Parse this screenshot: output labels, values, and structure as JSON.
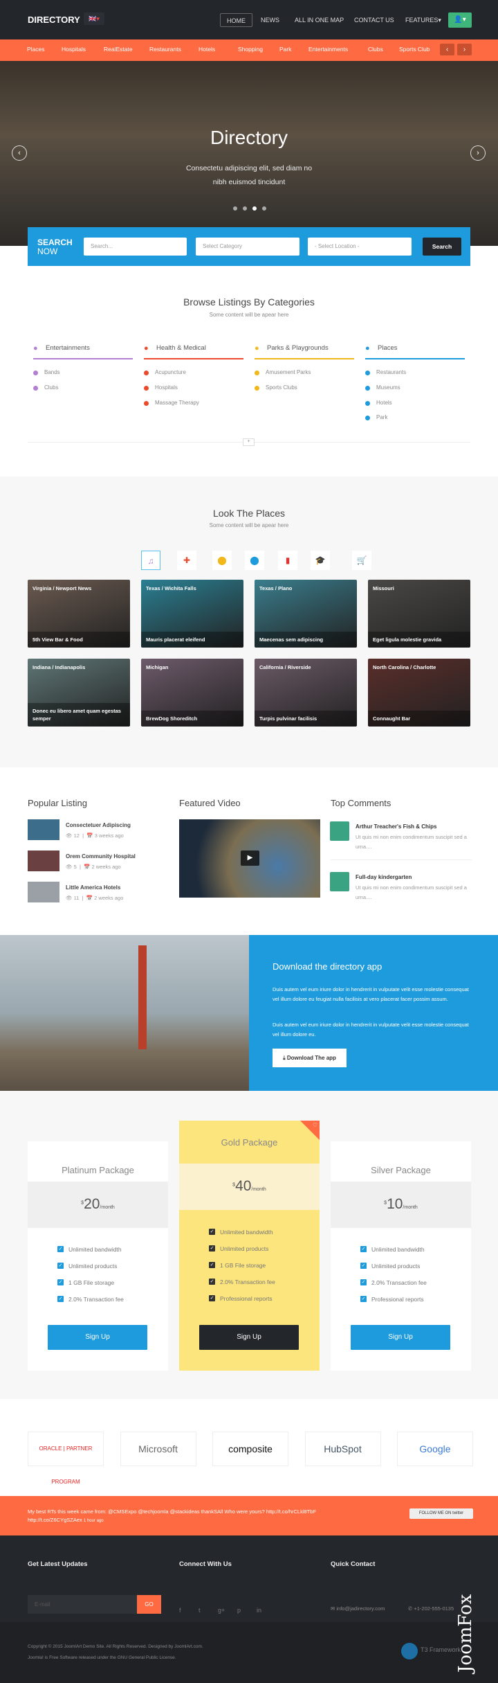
{
  "header": {
    "logo": "DIRECTORY",
    "lang": "🇬🇧▾",
    "nav": [
      "HOME",
      "NEWS",
      "ALL IN ONE MAP",
      "CONTACT US",
      "FEATURES▾"
    ],
    "user_icon": "user-icon"
  },
  "category_bar": {
    "items": [
      "Places",
      "Hospitals",
      "RealEstate",
      "Restaurants",
      "Hotels",
      "Shopping",
      "Park",
      "Entertainments",
      "Clubs",
      "Sports Club"
    ],
    "prev": "‹",
    "next": "›"
  },
  "hero": {
    "title": "Directory",
    "subtitle": "Consectetu adipiscing elit, sed diam no nibh euismod tincidunt",
    "slides": 4,
    "active_slide": 3
  },
  "search": {
    "title": "SEARCH",
    "title2": "NOW",
    "placeholder": "Search...",
    "category": "Select Category",
    "location": "- Select Location -",
    "button": "Search",
    "color": "#1e9bdc"
  },
  "browse": {
    "title": "Browse Listings By Categories",
    "subtitle": "Some content will be apear here",
    "more": "+",
    "columns": [
      {
        "name": "Entertainments",
        "color": "#b37fd3",
        "icon": "music-icon",
        "items": [
          "Bands",
          "Clubs"
        ]
      },
      {
        "name": "Health & Medical",
        "color": "#ec4a2c",
        "icon": "ambulance-icon",
        "items": [
          "Acupuncture",
          "Hospitals",
          "Massage Therapy"
        ]
      },
      {
        "name": "Parks & Playgrounds",
        "color": "#f2b71a",
        "icon": "map-marker-icon",
        "items": [
          "Amusement Parks",
          "Sports Clubs"
        ]
      },
      {
        "name": "Places",
        "color": "#1e9bdc",
        "icon": "map-marker-icon",
        "items": [
          "Restaurants",
          "Museums",
          "Hotels",
          "Park"
        ]
      }
    ]
  },
  "places": {
    "title": "Look The Places",
    "subtitle": "Some content will be apear here",
    "filters": [
      {
        "icon": "music-icon",
        "glyph": "♫",
        "color": "#b37fd3"
      },
      {
        "icon": "ambulance-icon",
        "glyph": "✚",
        "color": "#ec4a2c"
      },
      {
        "icon": "map-marker-icon",
        "glyph": "⬤",
        "color": "#f2b71a"
      },
      {
        "icon": "map-marker-icon",
        "glyph": "⬤",
        "color": "#1e9bdc"
      },
      {
        "icon": "building-icon",
        "glyph": "▮",
        "color": "#d33"
      },
      {
        "icon": "graduation-cap-icon",
        "glyph": "🎓",
        "color": "#222"
      },
      {
        "icon": "cart-icon",
        "glyph": "🛒",
        "color": "#6c3"
      }
    ],
    "cards": [
      {
        "location": "Virginia / Newport News",
        "name": "5th View Bar & Food"
      },
      {
        "location": "Texas / Wichita Falls",
        "name": "Mauris placerat eleifend"
      },
      {
        "location": "Texas / Plano",
        "name": "Maecenas sem adipiscing"
      },
      {
        "location": "Missouri",
        "name": "Eget ligula molestie gravida"
      },
      {
        "location": "Indiana / Indianapolis",
        "name": "Donec eu libero amet quam egestas semper"
      },
      {
        "location": "Michigan",
        "name": "BrewDog Shoreditch"
      },
      {
        "location": "California / Riverside",
        "name": "Turpis pulvinar facilisis"
      },
      {
        "location": "North Carolina / Charlotte",
        "name": "Connaught Bar"
      }
    ]
  },
  "popular": {
    "title": "Popular Listing",
    "items": [
      {
        "name": "Consectetuer Adipiscing",
        "views": "12",
        "date": "3 weeks ago"
      },
      {
        "name": "Orem Community Hospital",
        "views": "5",
        "date": "2 weeks ago"
      },
      {
        "name": "Little America Hotels",
        "views": "11",
        "date": "2 weeks ago"
      }
    ]
  },
  "video": {
    "title": "Featured Video"
  },
  "comments": {
    "title": "Top Comments",
    "items": [
      {
        "name": "Arthur Treacher's Fish & Chips",
        "text": "Ut quis mi non enim condimentum suscipit sed a urna...."
      },
      {
        "name": "Full-day kindergarten",
        "text": "Ut quis mi non enim condimentum suscipit sed a urna...."
      }
    ]
  },
  "app": {
    "title": "Download the directory app",
    "p1": "Duis autem vel eum iriure dolor in hendrerit in vulputate velit esse molestie consequat vel illum dolore eu feugiat nulla facilisis at vero placerat facer possim assum.",
    "p2": "Duis autem vel eum iriure dolor in hendrerit in vulputate velit esse molestie consequat vel illum dolore eu.",
    "button": "Download The app"
  },
  "pricing": [
    {
      "name": "Platinum Package",
      "currency": "$",
      "price": "20",
      "per": "/month",
      "features": [
        "Unlimited bandwidth",
        "Unlimited products",
        "1 GB File storage",
        "2.0% Transaction fee"
      ],
      "button": "Sign Up"
    },
    {
      "name": "Gold Package",
      "currency": "$",
      "price": "40",
      "per": "/month",
      "features": [
        "Unlimited bandwidth",
        "Unlimited products",
        "1 GB File storage",
        "2.0% Transaction fee",
        "Professional reports"
      ],
      "button": "Sign Up",
      "featured": true
    },
    {
      "name": "Silver Package",
      "currency": "$",
      "price": "10",
      "per": "/month",
      "features": [
        "Unlimited bandwidth",
        "Unlimited products",
        "2.0% Transaction fee",
        "Professional reports"
      ],
      "button": "Sign Up"
    }
  ],
  "brands": [
    "ORACLE | PARTNER PROGRAM",
    "Microsoft",
    "composite",
    "HubSpot",
    "Google"
  ],
  "twitter": {
    "text": "My best RTs this week came from: @CMSExpo @techjoomla @stackideas thankSAll Who were yours? http://t.co/hrCLkl8TbF http://t.co/Z6CYgSZAex",
    "time": "1 hour ago",
    "follow": "FOLLOW ME ON twitter"
  },
  "footer": {
    "updates_title": "Get Latest Updates",
    "email_placeholder": "E-mail",
    "go": "GO",
    "connect_title": "Connect With Us",
    "social": [
      "f",
      "t",
      "g+",
      "p",
      "in"
    ],
    "contact_title": "Quick Contact",
    "email": "info@jadirectory.com",
    "phone": "+1-202-555-0135",
    "copyright": "Copyright © 2015 JoomlArt Demo Site. All Rights Reserved. Designed by JoomlArt.com.",
    "license": "Joomla! is Free Software released under the GNU General Public License.",
    "t3": "T3 Framework",
    "watermark": "JoomFox CREATIVE WEB STUDIO"
  }
}
